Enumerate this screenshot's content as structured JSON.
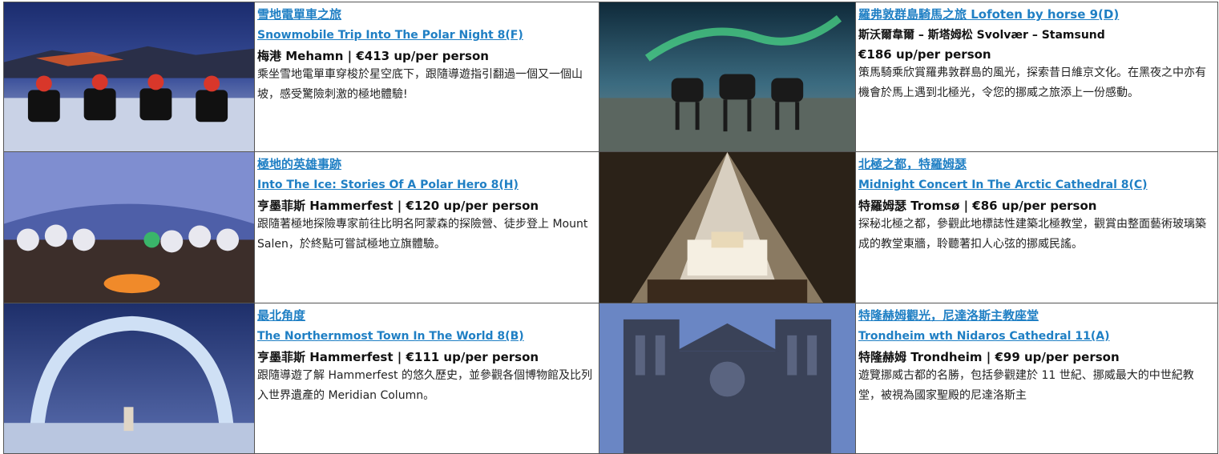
{
  "tours": [
    {
      "title_zh": "雪地電單車之旅",
      "title_en": "Snowmobile Trip Into The Polar Night 8(F)",
      "location": "梅港 Mehamn | €413 up/per person",
      "description": "乘坐雪地電單車穿梭於星空底下，跟隨導遊指引翻過一個又一個山坡，感受驚險刺激的極地體驗!",
      "image": "snowmobile-night-photo"
    },
    {
      "title_zh": "羅弗敦群島騎馬之旅 Lofoten by horse 9(D)",
      "title_en": "",
      "location": "斯沃爾韋爾 – 斯塔姆松 Svolvær – Stamsund",
      "location2": "€186 up/per person",
      "description": "策馬騎乘欣賞羅弗敦群島的風光，探索昔日維京文化。在黑夜之中亦有機會於馬上遇到北極光，令您的挪威之旅添上一份感動。",
      "image": "horses-aurora-photo"
    },
    {
      "title_zh": "極地的英雄事跡",
      "title_en": "Into The Ice: Stories Of A Polar Hero 8(H)",
      "location": "亨墨菲斯 Hammerfest | €120 up/per person",
      "description": "跟隨著極地探險專家前往比明名阿蒙森的探險營、徒步登上 Mount Salen，於終點可嘗試極地立旗體驗。",
      "image": "tent-group-photo"
    },
    {
      "title_zh": "北極之都，特羅姆瑟",
      "title_en": "Midnight Concert In The Arctic Cathedral 8(C)",
      "location": "特羅姆瑟 Tromsø  |  €86 up/per person",
      "description": "探秘北極之都，參觀此地標誌性建築北極教堂，觀賞由整面藝術玻璃築成的教堂東牆，聆聽著扣人心弦的挪威民謠。",
      "image": "cathedral-interior-photo"
    },
    {
      "title_zh": "最北角度",
      "title_en": "The Northernmost Town In The World 8(B)",
      "location": "亨墨菲斯 Hammerfest | €111 up/per person",
      "description": "跟隨導遊了解 Hammerfest 的悠久歷史，並參觀各個博物館及比列入世界遺產的 Meridian Column。",
      "image": "snow-arch-photo"
    },
    {
      "title_zh": "特隆赫姆觀光，尼達洛斯主教座堂",
      "title_en": "Trondheim wth Nidaros Cathedral 11(A)",
      "location": "特隆赫姆 Trondheim  |  €99 up/per person",
      "description": "遊覽挪威古都的名勝，包括參觀建於 11 世紀、挪威最大的中世紀教堂，被視為國家聖殿的尼達洛斯主",
      "image": "nidaros-cathedral-photo"
    }
  ]
}
